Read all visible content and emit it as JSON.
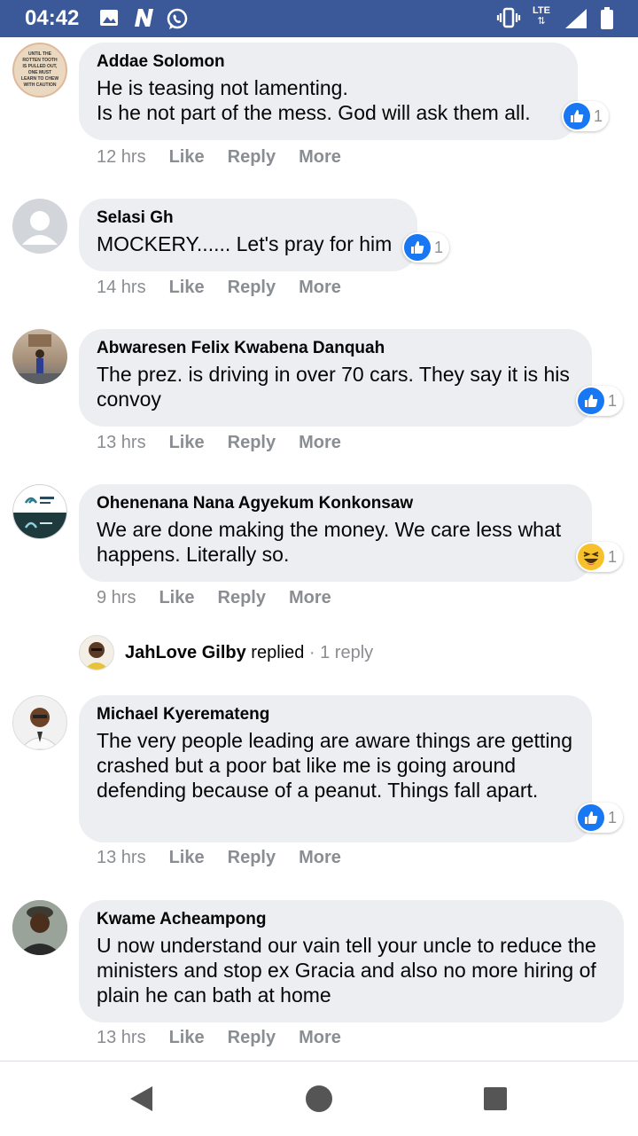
{
  "status_bar": {
    "time": "04:42",
    "network": "LTE",
    "icons": [
      "image-icon",
      "n-app-icon",
      "whatsapp-icon",
      "vibrate-icon",
      "signal-icon",
      "battery-icon"
    ]
  },
  "labels": {
    "like": "Like",
    "reply": "Reply",
    "more": "More"
  },
  "comments": [
    {
      "name": "Addae Solomon",
      "text": "He is teasing not lamenting.\nIs he not part of the mess. God will ask them all.",
      "time": "12 hrs",
      "reaction": "like",
      "reaction_count": "1",
      "avatar_text": "UNTIL THE ROTTEN TOOTH IS PULLED OUT, ONE MUST LEARN TO CHEW WITH CAUTION"
    },
    {
      "name": "Selasi Gh",
      "text": "MOCKERY...... Let's pray for him",
      "time": "14 hrs",
      "reaction": "like",
      "reaction_count": "1"
    },
    {
      "name": "Abwaresen Felix Kwabena Danquah",
      "text": "The prez. is driving in over 70 cars. They say it is his convoy",
      "time": "13 hrs",
      "reaction": "like",
      "reaction_count": "1"
    },
    {
      "name": "Ohenenana Nana Agyekum Konkonsaw",
      "text": "We are done making the money. We care less what happens. Literally so.",
      "time": "9 hrs",
      "reaction": "haha",
      "reaction_count": "1"
    },
    {
      "name": "Michael Kyeremateng",
      "text": "The very people leading are aware things are getting crashed but a poor bat like me is going around defending because of a peanut. Things fall apart.",
      "time": "13 hrs",
      "reaction": "like",
      "reaction_count": "1"
    },
    {
      "name": "Kwame Acheampong",
      "text": "U now understand our vain tell your uncle to reduce the ministers and stop ex Gracia and also no more hiring of plain he can bath at home",
      "time": "13 hrs"
    }
  ],
  "reply_summary": {
    "name": "JahLove Gilby",
    "action": "replied",
    "separator": "·",
    "count": "1 reply"
  },
  "colors": {
    "status_bar": "#3b5998",
    "bubble": "#eceef1",
    "like_blue": "#1877f2",
    "meta_gray": "#8a8d91"
  },
  "navigation": [
    "back-icon",
    "home-icon",
    "recents-icon"
  ]
}
